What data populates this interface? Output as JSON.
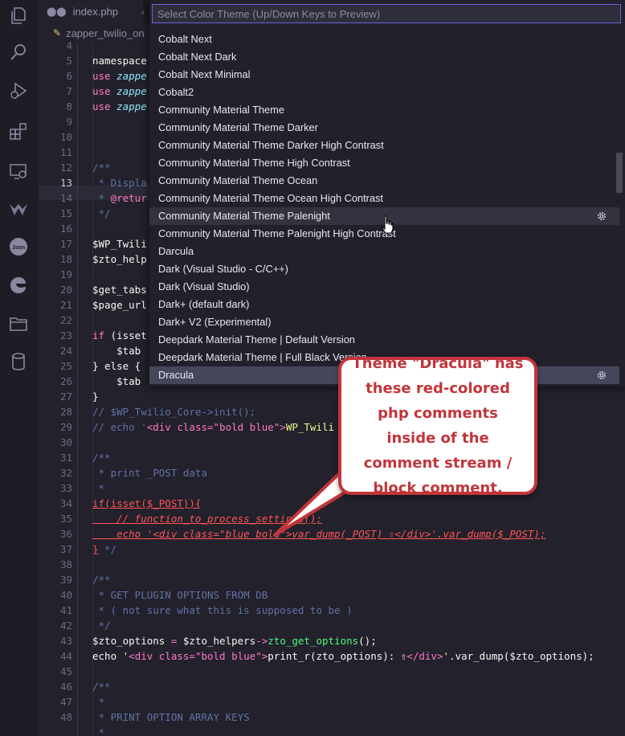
{
  "tabs": {
    "active_tab": "index.php",
    "more_indicator": "‹"
  },
  "breadcrumb": {
    "file": "zapper_twilio_on"
  },
  "picker": {
    "placeholder": "Select Color Theme (Up/Down Keys to Preview)",
    "items": [
      "Cobalt Next",
      "Cobalt Next Dark",
      "Cobalt Next Minimal",
      "Cobalt2",
      "Community Material Theme",
      "Community Material Theme Darker",
      "Community Material Theme Darker High Contrast",
      "Community Material Theme High Contrast",
      "Community Material Theme Ocean",
      "Community Material Theme Ocean High Contrast",
      "Community Material Theme Palenight",
      "Community Material Theme Palenight High Contrast",
      "Darcula",
      "Dark (Visual Studio - C/C++)",
      "Dark (Visual Studio)",
      "Dark+ (default dark)",
      "Dark+ V2 (Experimental)",
      "Deepdark Material Theme | Default Version",
      "Deepdark Material Theme | Full Black Version",
      "Dracula"
    ],
    "hovered_item": "Community Material Theme Palenight",
    "selected_item": "Dracula"
  },
  "callout": {
    "text": "Theme \"Dracula\" has these red-colored php comments inside of the comment stream / block comment.",
    "color": "#c2353a"
  },
  "editor": {
    "line_numbers": [
      "4",
      "5",
      "6",
      "7",
      "8",
      "9",
      "10",
      "11",
      "12",
      "13",
      "14",
      "15",
      "16",
      "17",
      "18",
      "19",
      "20",
      "21",
      "22",
      "23",
      "24",
      "25",
      "26",
      "27",
      "28",
      "29",
      "30",
      "31",
      "32",
      "33",
      "34",
      "35",
      "36",
      "37",
      "38",
      "39",
      "40",
      "41",
      "42",
      "43",
      "44",
      "45",
      "46",
      "47",
      "48"
    ],
    "lines": {
      "l4": "namespace",
      "l5_use": "use ",
      "l5_ns": "zappe",
      "l6_use": "use ",
      "l6_ns": "zappe",
      "l7_use": "use ",
      "l7_ns": "zappe",
      "l11": "/**",
      "l12": " * Displa",
      "l13_star": " * ",
      "l13_tag": "@retur",
      "l14": " */",
      "l16": "$WP_Twili",
      "l17": "$zto_help",
      "l19": "$get_tabs",
      "l20": "$page_url",
      "l22_if": "if ",
      "l22_rest": "(isset",
      "l23": "    $tab",
      "l24": "} else {",
      "l25": "    $tab",
      "l26": "}",
      "l27": "// $WP_Twilio_Core->init();",
      "l28_a": "// echo '",
      "l28_b": "<div class=\"bold blue\">",
      "l28_c": "WP_Twili",
      "l30": "/**",
      "l31": " * print _POST data",
      "l32": " *",
      "l33": "if(isset($_POST)){",
      "l34": "    // function_to_process_settings();",
      "l35": "    echo '<div class=\"blue bold\">var_dump(_POST) ⇧</div>'.var_dump($_POST);",
      "l36_a": "}",
      "l36_b": " */",
      "l38": "/**",
      "l39": " * GET PLUGIN OPTIONS FROM DB",
      "l40": " * ( not sure what this is supposed to be )",
      "l41": " */",
      "l42_a": "$zto_options",
      "l42_b": " = ",
      "l42_c": "$zto_helpers",
      "l42_d": "->",
      "l42_e": "zto_get_options",
      "l42_f": "();",
      "l43_a": "echo ",
      "l43_b": "'",
      "l43_c": "<div class=\"bold blue\">",
      "l43_d": "print_r(zto_options): ⇧",
      "l43_e": "</div>",
      "l43_f": "'",
      "l43_g": ".var_dump(",
      "l43_h": "$zto_options",
      "l43_i": ");",
      "l45": "/**",
      "l46": " *",
      "l47": " * PRINT OPTION ARRAY KEYS",
      "l48": " *"
    }
  },
  "activity_bar": {
    "icons": [
      "explorer-icon",
      "search-icon",
      "run-debug-icon",
      "extensions-icon",
      "remote-explorer-icon",
      "source-control-icon",
      "json-icon",
      "edge-icon",
      "folder-icon",
      "database-icon"
    ],
    "json_label": "Json"
  }
}
